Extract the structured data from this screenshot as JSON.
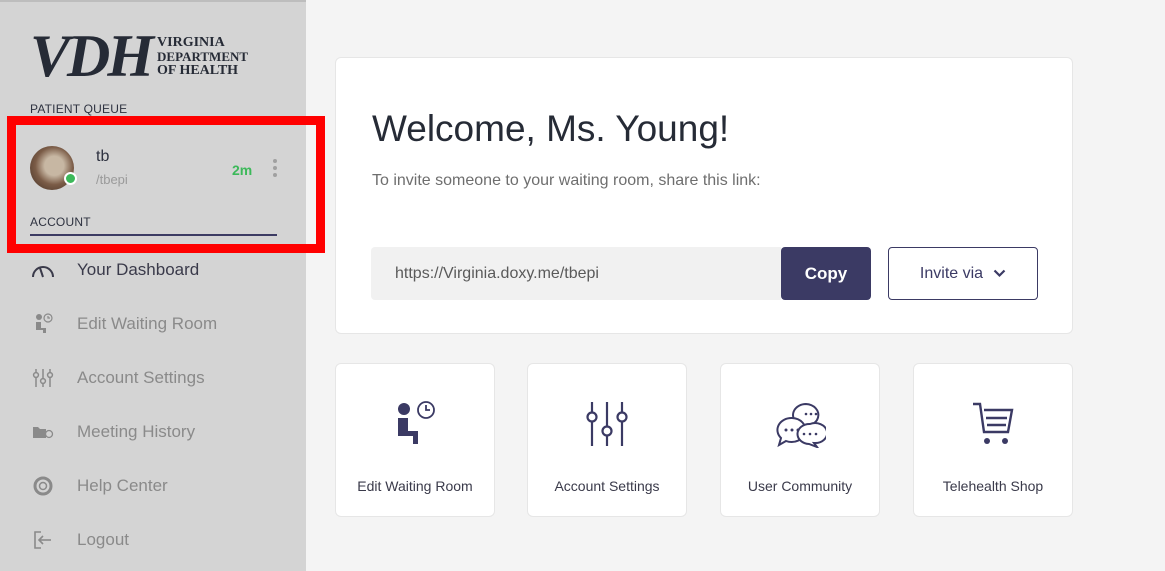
{
  "logo": {
    "mark": "VDH",
    "line1": "VIRGINIA",
    "line2": "DEPARTMENT",
    "line3": "OF HEALTH"
  },
  "sidebar": {
    "queue_label": "PATIENT QUEUE",
    "patient": {
      "name": "tb",
      "room": "/tbepi",
      "wait_time": "2m",
      "status_color": "#3cb95a"
    },
    "account_label": "ACCOUNT",
    "items": [
      {
        "label": "Your Dashboard",
        "icon": "dashboard-gauge-icon"
      },
      {
        "label": "Edit Waiting Room",
        "icon": "waiting-room-icon"
      },
      {
        "label": "Account Settings",
        "icon": "settings-sliders-icon"
      },
      {
        "label": "Meeting History",
        "icon": "meeting-history-icon"
      },
      {
        "label": "Help Center",
        "icon": "help-lifebuoy-icon"
      },
      {
        "label": "Logout",
        "icon": "logout-icon"
      }
    ]
  },
  "welcome": {
    "title": "Welcome, Ms. Young!",
    "subtitle": "To invite someone to your waiting room, share this link:",
    "link": "https://Virginia.doxy.me/tbepi",
    "copy_label": "Copy",
    "invite_label": "Invite via"
  },
  "tiles": [
    {
      "label": "Edit Waiting Room",
      "icon": "waiting-room-icon"
    },
    {
      "label": "Account Settings",
      "icon": "settings-sliders-icon"
    },
    {
      "label": "User Community",
      "icon": "chat-bubbles-icon"
    },
    {
      "label": "Telehealth Shop",
      "icon": "shopping-cart-icon"
    }
  ],
  "colors": {
    "accent": "#3b3a64",
    "online": "#3cb95a",
    "highlight": "#ff0000"
  }
}
